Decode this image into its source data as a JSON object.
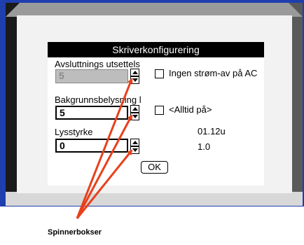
{
  "dialog": {
    "title": "Skriverkonfigurering",
    "shutdown_delay": {
      "label": "Avsluttnings utsettels",
      "value": "5"
    },
    "backlight": {
      "label": "Bakgrunnsbelysning l",
      "value": "5"
    },
    "brightness": {
      "label": "Lysstyrke",
      "value": "0"
    },
    "no_power_off_ac": {
      "label": "Ingen strøm-av på AC",
      "checked": false
    },
    "always_on": {
      "label": "<Alltid på>",
      "checked": false
    },
    "version_line1": "01.12u",
    "version_line2": "1.0",
    "ok_label": "OK"
  },
  "annotation": {
    "caption": "Spinnerbokser",
    "arrow_color": "#e8401c"
  },
  "colors": {
    "frame_blue": "#1f3fae",
    "title_bg": "#000000"
  }
}
